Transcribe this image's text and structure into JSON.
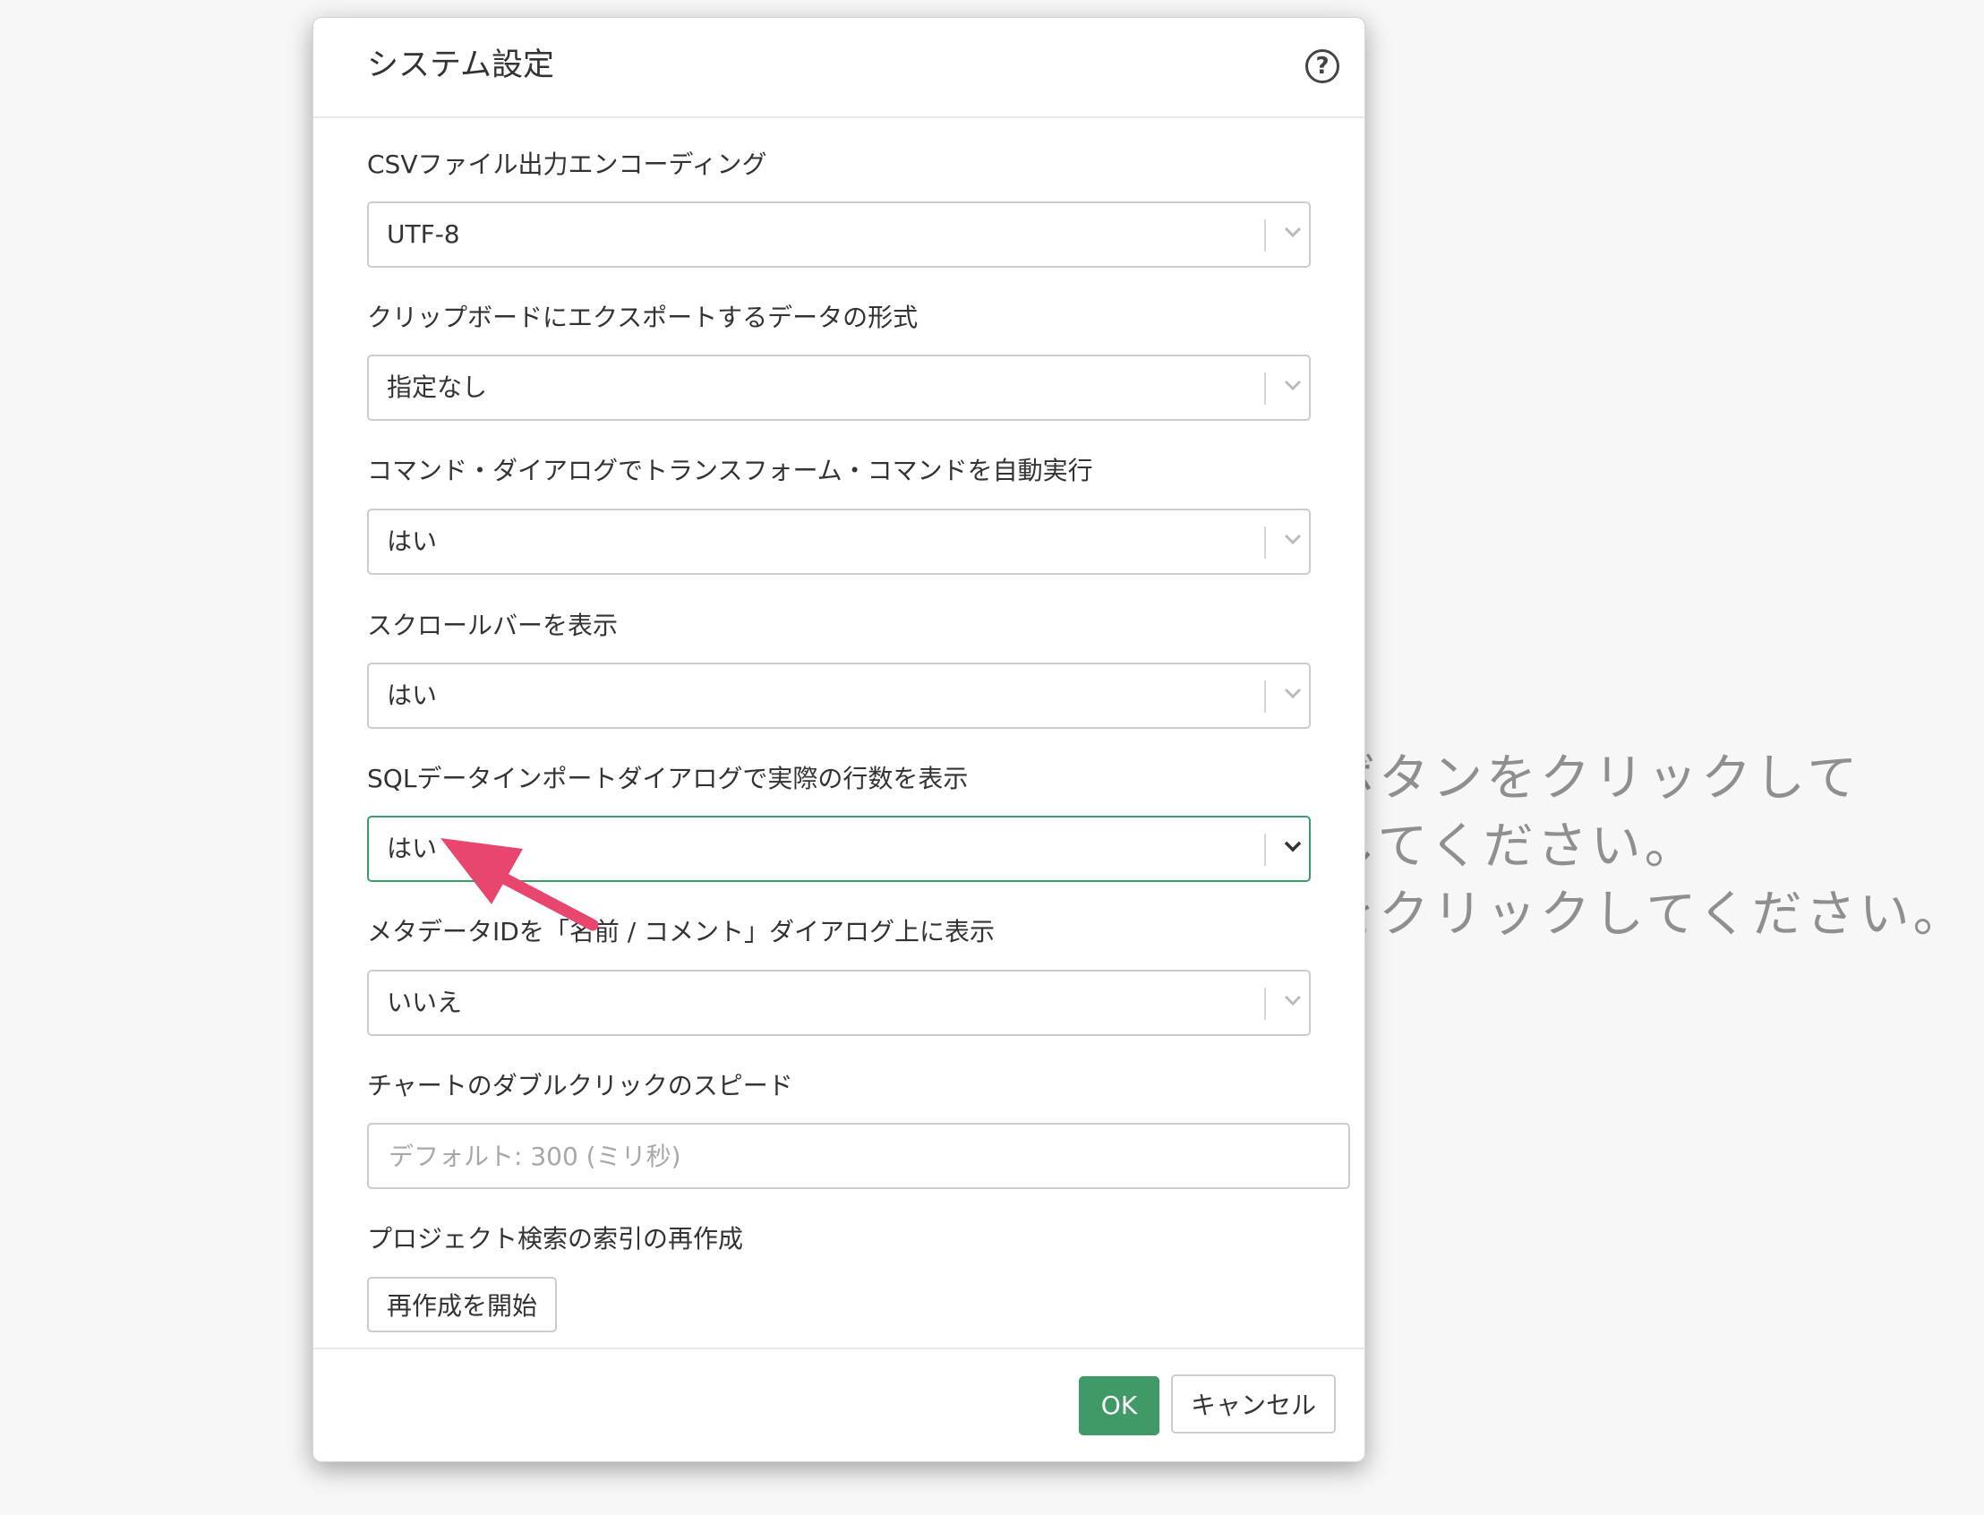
{
  "background": {
    "lines": [
      "ボタンをクリックして",
      "してください。",
      "をクリックしてください。"
    ]
  },
  "dialog": {
    "title": "システム設定",
    "help_icon": "question-circle-icon",
    "help_glyph": "?",
    "fields": [
      {
        "label": "CSVファイル出力エンコーディング",
        "value": "UTF-8"
      },
      {
        "label": "クリップボードにエクスポートするデータの形式",
        "value": "指定なし"
      },
      {
        "label": "コマンド・ダイアログでトランスフォーム・コマンドを自動実行",
        "value": "はい"
      },
      {
        "label": "スクロールバーを表示",
        "value": "はい"
      },
      {
        "label": "SQLデータインポートダイアログで実際の行数を表示",
        "value": "はい"
      },
      {
        "label": "メタデータIDを「名前 / コメント」ダイアログ上に表示",
        "value": "いいえ"
      }
    ],
    "double_click": {
      "label": "チャートのダブルクリックのスピード",
      "value": "",
      "placeholder": "デフォルト: 300 (ミリ秒)"
    },
    "rebuild": {
      "label": "プロジェクト検索の索引の再作成",
      "button_label": "再作成を開始"
    },
    "footer": {
      "ok_label": "OK",
      "cancel_label": "キャンセル"
    }
  },
  "colors": {
    "accent": "#3f9a67",
    "arrow": "#e8466e"
  }
}
